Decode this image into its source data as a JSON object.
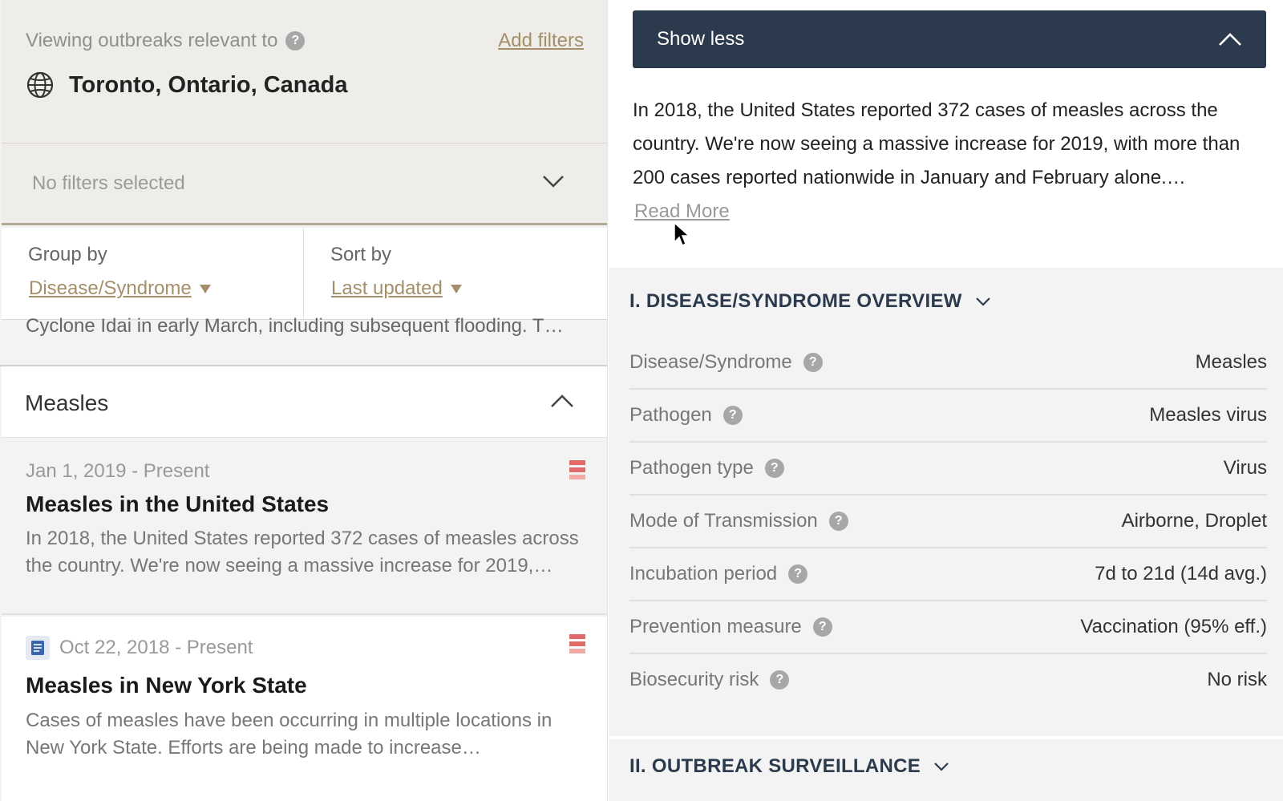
{
  "filters": {
    "viewing_label": "Viewing outbreaks relevant to",
    "add_filters_label": "Add filters",
    "location": "Toronto, Ontario, Canada",
    "no_filters_label": "No filters selected"
  },
  "group_by": {
    "label": "Group by",
    "value": "Disease/Syndrome"
  },
  "sort_by": {
    "label": "Sort by",
    "value": "Last updated"
  },
  "truncated_text": "Cyclone Idai in early March, including subsequent flooding. T…",
  "group": {
    "title": "Measles"
  },
  "outbreaks": [
    {
      "date": "Jan 1, 2019 - Present",
      "title": "Measles in the United States",
      "description": "In 2018, the United States reported 372 cases of measles across the country. We're now seeing a massive increase for 2019,…"
    },
    {
      "date": "Oct 22, 2018 - Present",
      "title": "Measles in New York State",
      "description": "Cases of measles have been occurring in multiple locations in New York State. Efforts are being made to increase…"
    }
  ],
  "detail": {
    "show_less_label": "Show less",
    "summary": "In 2018, the United States reported 372 cases of measles across the country. We're now seeing a massive increase for 2019, with more than 200 cases reported nationwide in January and February alone.…",
    "read_more_label": "Read More"
  },
  "overview": {
    "title": "I. DISEASE/SYNDROME OVERVIEW",
    "rows": [
      {
        "label": "Disease/Syndrome",
        "value": "Measles"
      },
      {
        "label": "Pathogen",
        "value": "Measles virus"
      },
      {
        "label": "Pathogen type",
        "value": "Virus"
      },
      {
        "label": "Mode of Transmission",
        "value": "Airborne, Droplet"
      },
      {
        "label": "Incubation period",
        "value": "7d to 21d (14d avg.)"
      },
      {
        "label": "Prevention measure",
        "value": "Vaccination (95% eff.)"
      },
      {
        "label": "Biosecurity risk",
        "value": "No risk"
      }
    ]
  },
  "surveillance": {
    "title": "II. OUTBREAK SURVEILLANCE"
  },
  "icons": {
    "help": "question-circle-icon",
    "globe": "globe-icon",
    "chevron_down": "chevron-down-icon",
    "chevron_up": "chevron-up-icon",
    "severity": "severity-bars-icon",
    "document": "document-icon",
    "cursor": "mouse-pointer-icon"
  },
  "colors": {
    "accent_gold": "#a58f6a",
    "navy": "#2c3a4d",
    "severity_red": "#d9534f"
  }
}
